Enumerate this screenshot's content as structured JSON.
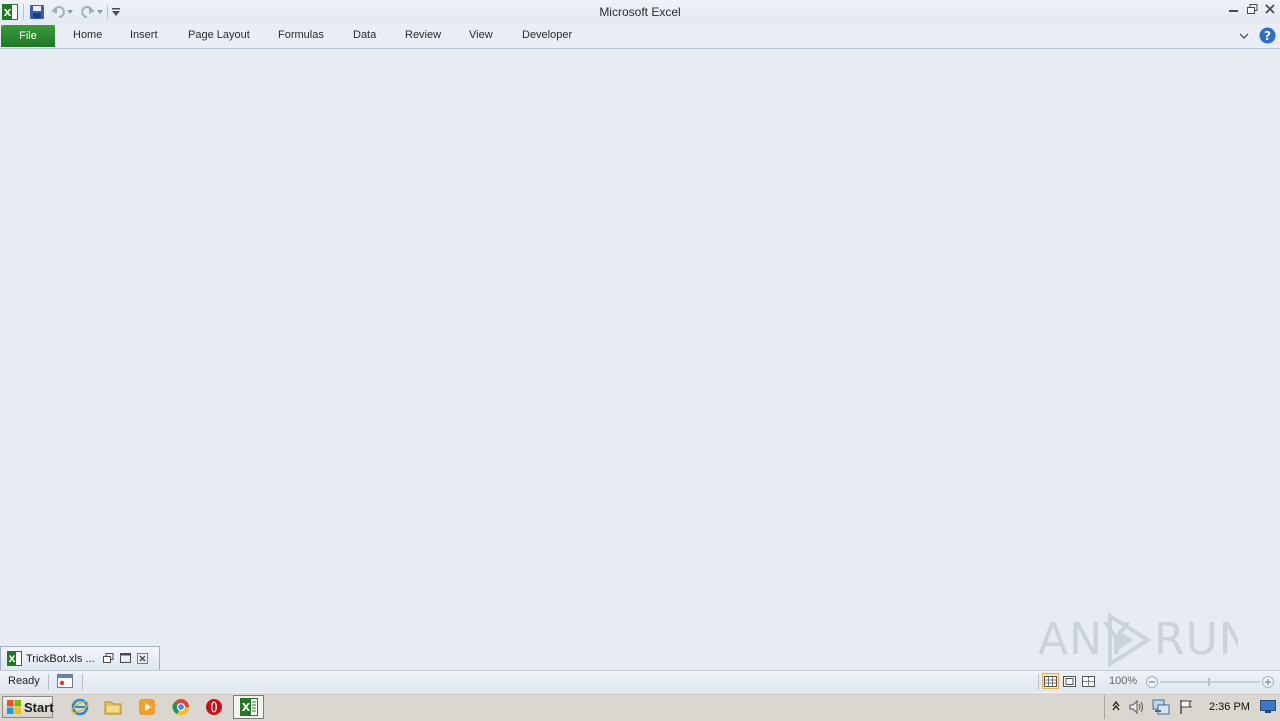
{
  "window": {
    "title": "Microsoft Excel"
  },
  "ribbon": {
    "tabs": [
      "File",
      "Home",
      "Insert",
      "Page Layout",
      "Formulas",
      "Data",
      "Review",
      "View",
      "Developer"
    ]
  },
  "workbook": {
    "minimized_title": "TrickBot.xls  ..."
  },
  "statusbar": {
    "status": "Ready",
    "zoom": "100%"
  },
  "taskbar": {
    "start_label": "Start",
    "clock": "2:36 PM"
  },
  "watermark": {
    "text": "ANY RUN"
  },
  "colors": {
    "file_tab": "#2a8a2f",
    "background": "#e7ecf3",
    "excel_green": "#1f7a23"
  }
}
